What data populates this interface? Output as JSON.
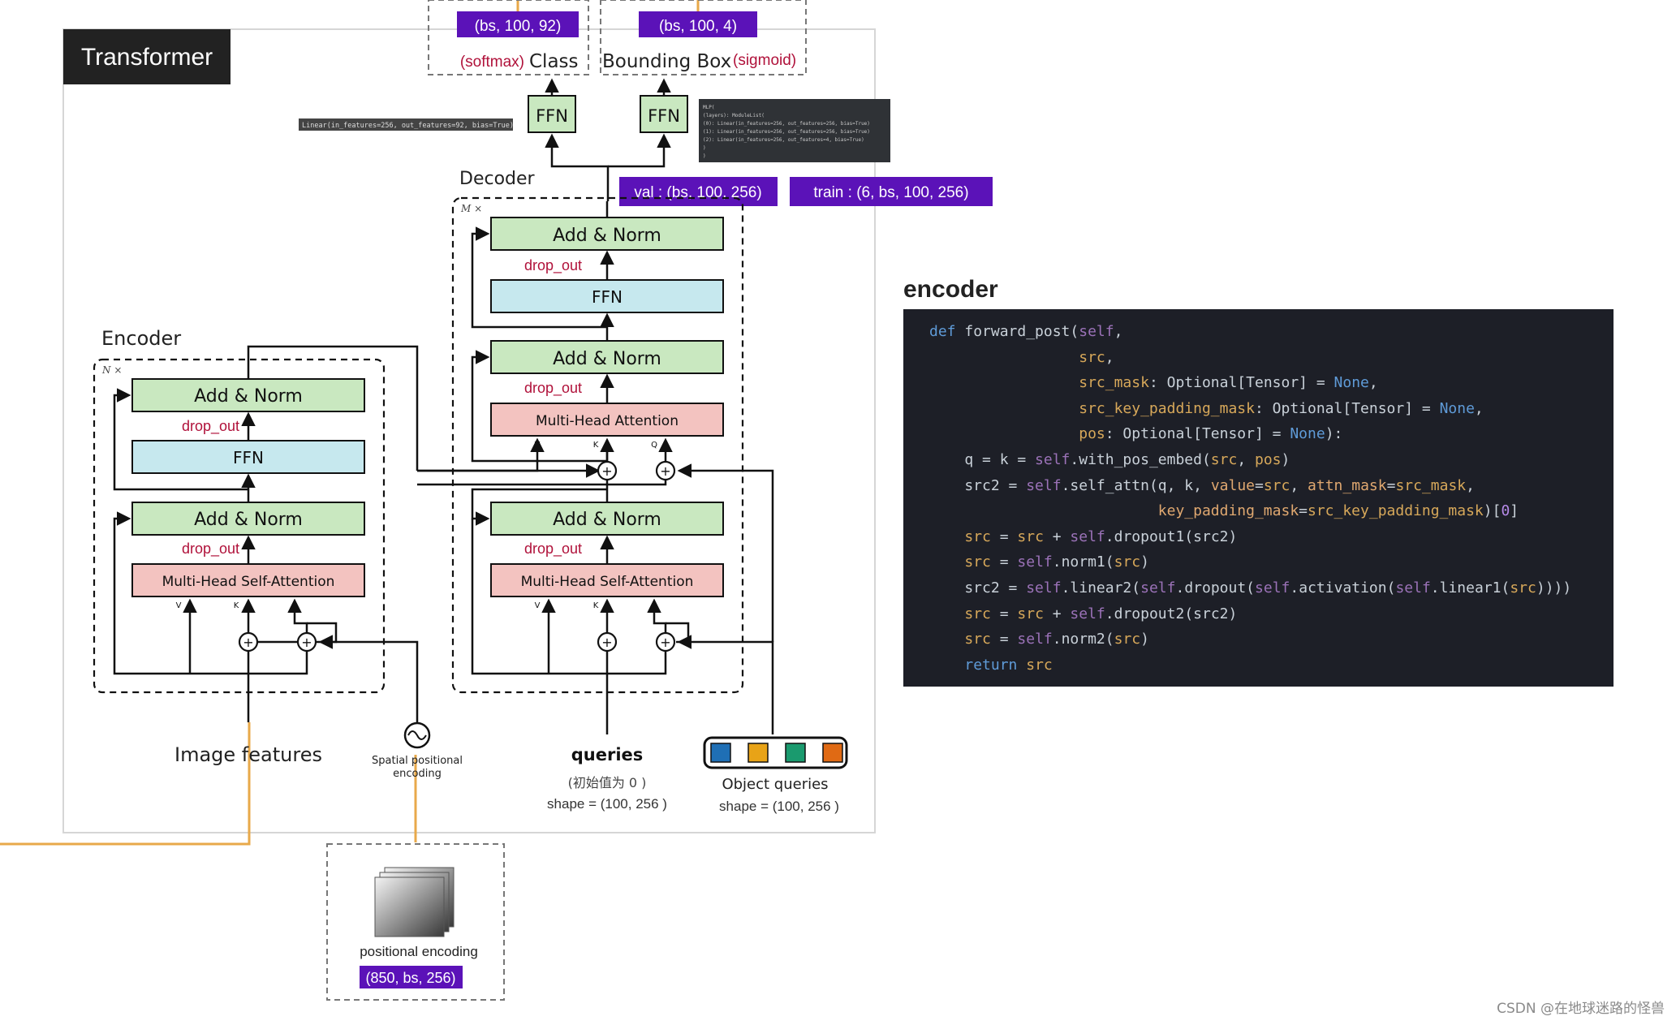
{
  "diagram": {
    "title": "Transformer",
    "encoder_label": "Encoder",
    "decoder_label": "Decoder",
    "encoder_repeat": "N ×",
    "decoder_repeat": "M ×",
    "add_norm": "Add & Norm",
    "ffn": "FFN",
    "drop_out": "drop_out",
    "self_attention": "Multi-Head Self-Attention",
    "multi_head_attention": "Multi-Head Attention",
    "v": "V",
    "k": "K",
    "q": "Q",
    "image_features": "Image features",
    "spatial_encoding_1": "Spatial positional",
    "spatial_encoding_2": "encoding",
    "queries": "queries",
    "queries_init": "(初始值为 0 )",
    "queries_shape": "shape = (100, 256 )",
    "object_queries": "Object queries",
    "object_queries_shape": "shape = (100, 256 )",
    "object_query_colors": [
      "#1f6fb5",
      "#e8a317",
      "#1a9a6e",
      "#e06a14"
    ],
    "ffn_head": "FFN",
    "class_shape": "(bs, 100, 92)",
    "bbox_shape": "(bs, 100, 4)",
    "softmax": "(softmax)",
    "class_label": "Class",
    "bbox_label": "Bounding Box",
    "sigmoid": "(sigmoid)",
    "linear_tooltip": "Linear(in_features=256, out_features=92, bias=True)",
    "mlp_tooltip": [
      "MLP(",
      "  (layers): ModuleList(",
      "    (0): Linear(in_features=256, out_features=256, bias=True)",
      "    (1): Linear(in_features=256, out_features=256, bias=True)",
      "    (2): Linear(in_features=256, out_features=4, bias=True)",
      "  )",
      ")"
    ],
    "val_shape": "val : (bs, 100, 256)",
    "train_shape": "train : (6, bs, 100, 256)",
    "positional_encoding": "positional encoding",
    "positional_shape": "(850, bs, 256)"
  },
  "code": {
    "title": "encoder",
    "lines": [
      "def forward_post(self,",
      "                 src,",
      "                 src_mask: Optional[Tensor] = None,",
      "                 src_key_padding_mask: Optional[Tensor] = None,",
      "                 pos: Optional[Tensor] = None):",
      "    q = k = self.with_pos_embed(src, pos)",
      "    src2 = self.self_attn(q, k, value=src, attn_mask=src_mask,",
      "                          key_padding_mask=src_key_padding_mask)[0]",
      "    src = src + self.dropout1(src2)",
      "    src = self.norm1(src)",
      "    src2 = self.linear2(self.dropout(self.activation(self.linear1(src))))",
      "    src = src + self.dropout2(src2)",
      "    src = self.norm2(src)",
      "    return src"
    ]
  },
  "watermark": "CSDN @在地球迷路的怪兽",
  "colors": {
    "add_norm_fill": "#c9e8c0",
    "ffn_fill": "#c6e8ee",
    "attention_fill": "#f3c3c0",
    "shape_badge": "#5b12b8",
    "drop_out_text": "#b0113a",
    "accent_line": "#e8a94a",
    "code_bg": "#1d1f27"
  }
}
